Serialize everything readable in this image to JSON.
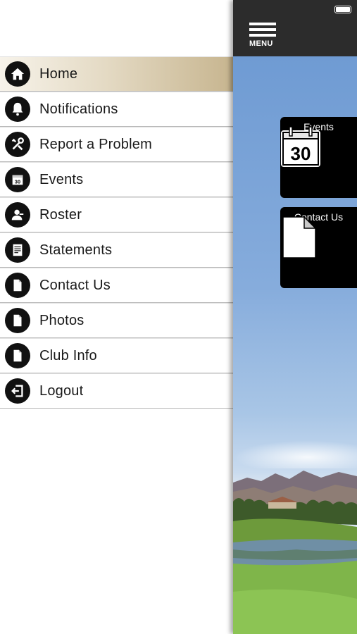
{
  "drawer": {
    "items": [
      {
        "label": "Home",
        "icon": "home-icon",
        "active": true
      },
      {
        "label": "Notifications",
        "icon": "bell-icon"
      },
      {
        "label": "Report a Problem",
        "icon": "tools-icon"
      },
      {
        "label": "Events",
        "icon": "calendar-icon"
      },
      {
        "label": "Roster",
        "icon": "person-icon"
      },
      {
        "label": "Statements",
        "icon": "statement-icon"
      },
      {
        "label": "Contact Us",
        "icon": "document-icon"
      },
      {
        "label": "Photos",
        "icon": "document-icon"
      },
      {
        "label": "Club Info",
        "icon": "document-icon"
      },
      {
        "label": "Logout",
        "icon": "logout-icon"
      }
    ]
  },
  "header": {
    "menu_label": "MENU"
  },
  "tiles": {
    "events": {
      "label": "Events",
      "calendar_day": "30"
    },
    "contact": {
      "label": "Contact Us"
    }
  },
  "colors": {
    "header_bg": "#2c2c2c",
    "active_item_gold": "#c7b58f",
    "tile_bg": "#000000"
  }
}
